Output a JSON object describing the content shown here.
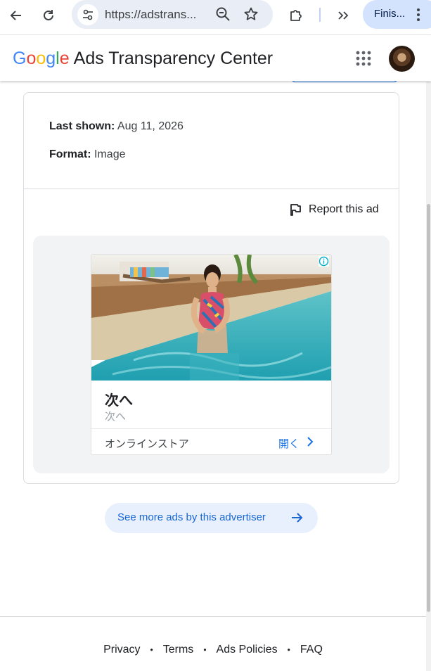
{
  "browser": {
    "url": "https://adstrans...",
    "profile_label": "Finis..."
  },
  "header": {
    "logo_letters": [
      "G",
      "o",
      "o",
      "g",
      "l",
      "e"
    ],
    "title": "Ads Transparency Center"
  },
  "ad_details": {
    "last_shown_label": "Last shown:",
    "last_shown_value": "Aug 11, 2026",
    "format_label": "Format:",
    "format_value": "Image",
    "report_label": "Report this ad"
  },
  "ad_preview": {
    "headline": "次へ",
    "subheadline": "次へ",
    "store_label": "オンラインストア",
    "open_label": "開く",
    "info_icon": "info-icon"
  },
  "see_more": {
    "label": "See more ads by this advertiser"
  },
  "footer": {
    "links": [
      "Privacy",
      "Terms",
      "Ads Policies",
      "FAQ"
    ]
  },
  "colors": {
    "accent": "#1a73e8",
    "chip_bg": "#e8f0fe",
    "preview_bg": "#f1f3f4"
  }
}
